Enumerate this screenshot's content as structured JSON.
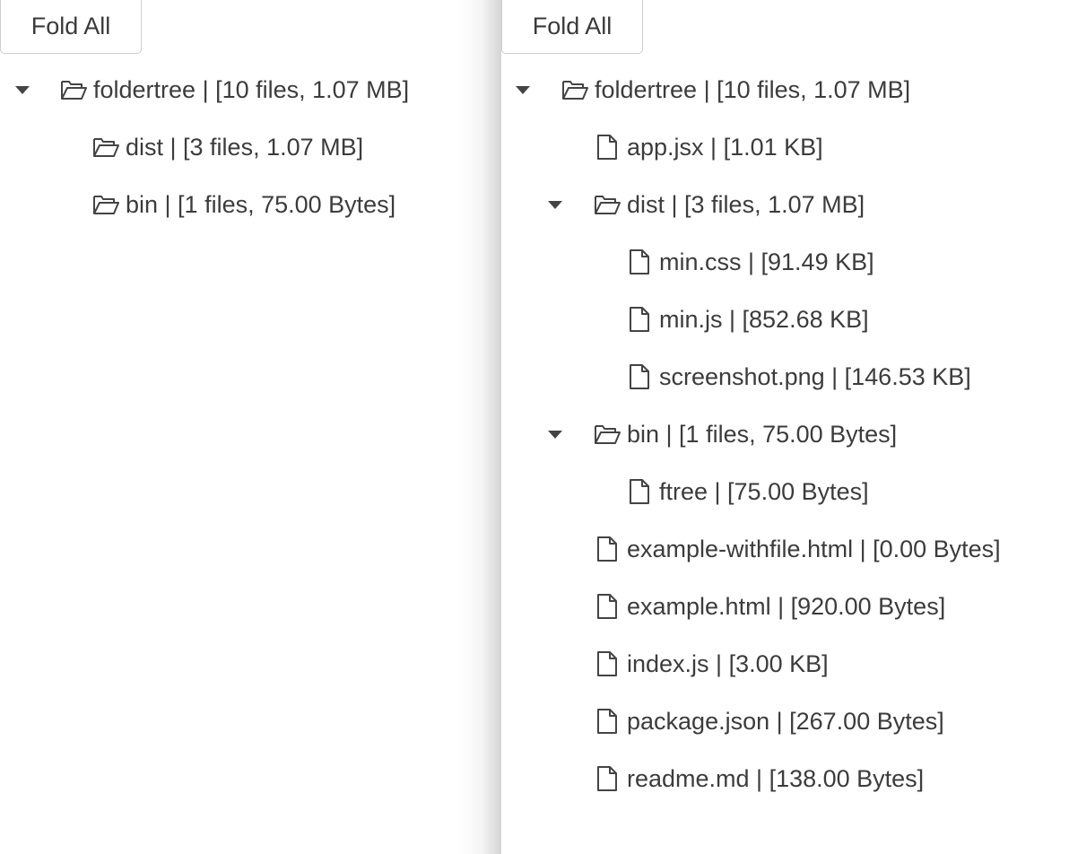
{
  "left": {
    "fold_label": "Fold All",
    "nodes": [
      {
        "type": "folder",
        "label": "foldertree | [10 files, 1.07 MB]",
        "expanded": true,
        "icon": "folder-open-icon"
      },
      {
        "type": "folder",
        "label": "dist | [3 files, 1.07 MB]",
        "expanded": false,
        "icon": "folder-open-icon"
      },
      {
        "type": "folder",
        "label": "bin | [1 files, 75.00 Bytes]",
        "expanded": false,
        "icon": "folder-open-icon"
      }
    ]
  },
  "right": {
    "fold_label": "Fold All",
    "nodes": [
      {
        "type": "folder",
        "label": "foldertree | [10 files, 1.07 MB]",
        "expanded": true,
        "icon": "folder-open-icon"
      },
      {
        "type": "file",
        "label": "app.jsx | [1.01 KB]",
        "icon": "file-icon"
      },
      {
        "type": "folder",
        "label": "dist | [3 files, 1.07 MB]",
        "expanded": true,
        "icon": "folder-open-icon"
      },
      {
        "type": "file",
        "label": "min.css | [91.49 KB]",
        "icon": "file-icon"
      },
      {
        "type": "file",
        "label": "min.js | [852.68 KB]",
        "icon": "file-icon"
      },
      {
        "type": "file",
        "label": "screenshot.png | [146.53 KB]",
        "icon": "file-icon"
      },
      {
        "type": "folder",
        "label": "bin | [1 files, 75.00 Bytes]",
        "expanded": true,
        "icon": "folder-open-icon"
      },
      {
        "type": "file",
        "label": "ftree | [75.00 Bytes]",
        "icon": "file-icon"
      },
      {
        "type": "file",
        "label": "example-withfile.html | [0.00 Bytes]",
        "icon": "file-icon"
      },
      {
        "type": "file",
        "label": "example.html | [920.00 Bytes]",
        "icon": "file-icon"
      },
      {
        "type": "file",
        "label": "index.js | [3.00 KB]",
        "icon": "file-icon"
      },
      {
        "type": "file",
        "label": "package.json | [267.00 Bytes]",
        "icon": "file-icon"
      },
      {
        "type": "file",
        "label": "readme.md | [138.00 Bytes]",
        "icon": "file-icon"
      }
    ]
  }
}
